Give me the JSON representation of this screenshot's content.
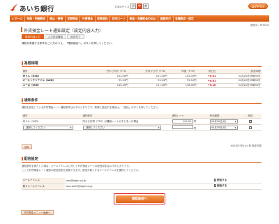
{
  "header": {
    "logo_text": "あいち銀行",
    "font_size_label": "文字のサイズ",
    "font_sizes": [
      "小",
      "中",
      "大"
    ],
    "logout": "ログアウト"
  },
  "nav": [
    "ホーム",
    "残高・明細照会",
    "振込・振替",
    "定期預金",
    "外貨預金",
    "投資信託",
    "住宅ローン",
    "税金・各種料金の払込",
    "諸届受付",
    "各種照会・設定"
  ],
  "screen_no": "画面ID：BFN003",
  "page_title": "外貨預金レート通知設定（設定内容入力）",
  "steps": [
    "設定内容入力",
    "入力内容確認",
    "設定完了"
  ],
  "guide_text": "通知を希望する条件をご入力のうえ、「確認画面へ」ボタンを押してください。",
  "rates": {
    "section_title": "為替相場",
    "headers": [
      "通貨",
      "円から外貨（TTS）",
      "外貨から円（TTB）",
      "仲値（TTM）",
      "前日比",
      "設定時間"
    ],
    "rows": [
      {
        "currency": "米ドル（USD）",
        "tts": "103.00円",
        "ttb": "101.00円",
        "ttm": "102.00円",
        "change": "+0.01",
        "time": "01月20日09時30分"
      },
      {
        "currency": "オーストラリアドル（AUD）",
        "tts": "95.54円",
        "ttb": "93.04円",
        "ttm": "95.54円",
        "change": "+0.01",
        "time": "01月20日09時30分"
      },
      {
        "currency": "ユーロ（EUR）",
        "tts": "140.40円",
        "ttb": "137.40円",
        "ttm": "138.90円",
        "change": "+0.10",
        "time": "01月20日09時30分"
      }
    ]
  },
  "conditions": {
    "section_title": "通知条件",
    "description": "通知を設定している外貨預金レート通知条件は以下のとおりです。新規に追加する場合は、「追加」ボタンを押してください。",
    "headers": [
      "通貨",
      "通知条件",
      "通知レート",
      "有効期限",
      "削除"
    ],
    "rows": [
      {
        "currency": "米ドル（USD）",
        "condition": "円から外貨（TTS）が通知レート以下となった場合",
        "rate": "100.00",
        "rate_unit": "円",
        "expiry": "04月29日(月)",
        "delete": true,
        "currency_is_select": false
      },
      {
        "currency": "--選択してください--",
        "condition": "--選択してください--",
        "rate": "",
        "rate_unit": "円",
        "expiry": "04月29日(月)",
        "delete": false,
        "currency_is_select": true
      }
    ],
    "add_button": "追加",
    "expiry_note": "※04月29日(火) 祝 指定可能"
  },
  "mail": {
    "section_title": "配信設定",
    "description1": "通知条件を満たした場合、メールアドレスに対して外貨預金レートの配信設定は以下のとおりです。",
    "description2": "ここで外貨預金レート通知の配信設定を変更できます。配信対象とするメールアドレスを選択してください。",
    "rows": [
      {
        "label": "メールアドレス",
        "address": "taro@aigin.co.jp",
        "checked": true,
        "action": "配信する"
      },
      {
        "label": "第２メールアドレス",
        "address": "taro-aichi@aigin.co.jp",
        "checked": true,
        "action": "配信する"
      }
    ]
  },
  "confirm_button": "確認画面へ",
  "back_button": "外貨預金メニュー画面へ"
}
